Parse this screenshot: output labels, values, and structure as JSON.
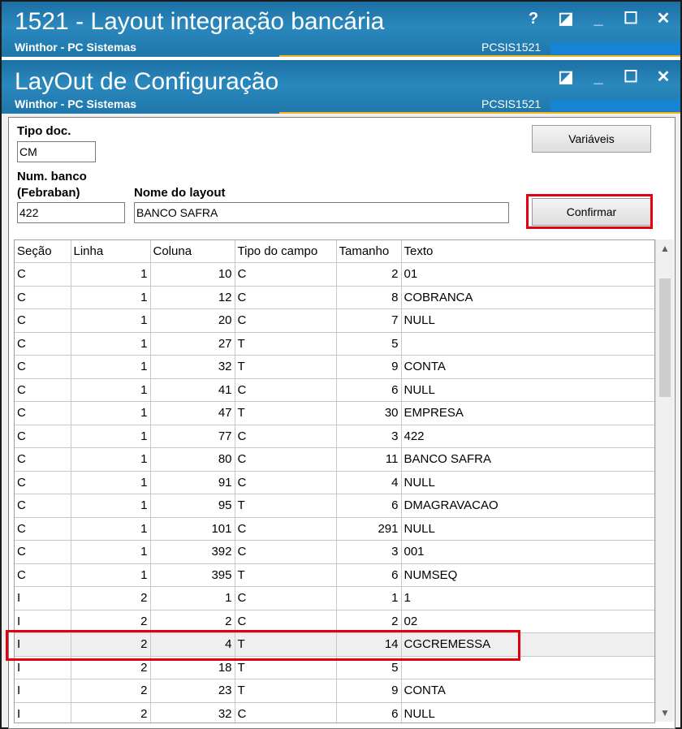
{
  "outer_window": {
    "title": "1521 - Layout integração bancária",
    "subtitle": "Winthor - PC Sistemas",
    "code": "PCSIS1521",
    "buttons": [
      "?",
      "◪",
      "_",
      "☐",
      "✕"
    ]
  },
  "inner_window": {
    "title": "LayOut de Configuração",
    "subtitle": "Winthor - PC Sistemas",
    "code": "PCSIS1521",
    "buttons": [
      "◪",
      "_",
      "☐",
      "✕"
    ]
  },
  "form": {
    "tipo_doc_label": "Tipo doc.",
    "tipo_doc_value": "CM",
    "num_banco_label_1": "Num. banco",
    "num_banco_label_2": "(Febraban)",
    "num_banco_value": "422",
    "nome_layout_label": "Nome do layout",
    "nome_layout_value": "BANCO SAFRA",
    "variaveis_button": "Variáveis",
    "confirmar_button": "Confirmar"
  },
  "grid": {
    "columns": [
      "Seção",
      "Linha",
      "Coluna",
      "Tipo do campo",
      "Tamanho",
      "Texto"
    ],
    "rows": [
      [
        "C",
        "1",
        "10",
        "C",
        "2",
        "01"
      ],
      [
        "C",
        "1",
        "12",
        "C",
        "8",
        "COBRANCA"
      ],
      [
        "C",
        "1",
        "20",
        "C",
        "7",
        "NULL"
      ],
      [
        "C",
        "1",
        "27",
        "T",
        "5",
        ""
      ],
      [
        "C",
        "1",
        "32",
        "T",
        "9",
        "CONTA"
      ],
      [
        "C",
        "1",
        "41",
        "C",
        "6",
        "NULL"
      ],
      [
        "C",
        "1",
        "47",
        "T",
        "30",
        "EMPRESA"
      ],
      [
        "C",
        "1",
        "77",
        "C",
        "3",
        "422"
      ],
      [
        "C",
        "1",
        "80",
        "C",
        "11",
        "BANCO SAFRA"
      ],
      [
        "C",
        "1",
        "91",
        "C",
        "4",
        "NULL"
      ],
      [
        "C",
        "1",
        "95",
        "T",
        "6",
        "DMAGRAVACAO"
      ],
      [
        "C",
        "1",
        "101",
        "C",
        "291",
        "NULL"
      ],
      [
        "C",
        "1",
        "392",
        "C",
        "3",
        "001"
      ],
      [
        "C",
        "1",
        "395",
        "T",
        "6",
        "NUMSEQ"
      ],
      [
        "I",
        "2",
        "1",
        "C",
        "1",
        "1"
      ],
      [
        "I",
        "2",
        "2",
        "C",
        "2",
        "02"
      ],
      [
        "I",
        "2",
        "4",
        "T",
        "14",
        "CGCREMESSA"
      ],
      [
        "I",
        "2",
        "18",
        "T",
        "5",
        ""
      ],
      [
        "I",
        "2",
        "23",
        "T",
        "9",
        "CONTA"
      ],
      [
        "I",
        "2",
        "32",
        "C",
        "6",
        "NULL"
      ]
    ],
    "selected_row": 16
  },
  "colors": {
    "titlebar": "#2a88bd",
    "accent_stripe": "#f5b321",
    "highlight": "#e3000f"
  }
}
